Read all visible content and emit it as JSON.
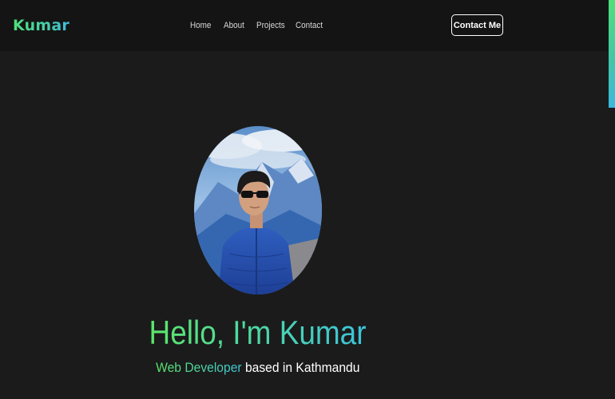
{
  "brand": {
    "logo_text": "Kumar"
  },
  "nav": {
    "links": [
      {
        "label": "Home"
      },
      {
        "label": "About"
      },
      {
        "label": "Projects"
      },
      {
        "label": "Contact"
      }
    ],
    "cta_label": "Contact Me"
  },
  "hero": {
    "headline": "Hello, I'm Kumar",
    "role": "Web Developer",
    "location_text": " based in Kathmandu",
    "avatar_alt": "profile-photo"
  },
  "scroll": {
    "progress": 0.27
  },
  "colors": {
    "background": "#1b1b1b",
    "navbar": "#141414",
    "accent_green": "#5be56a",
    "accent_cyan": "#3cc3dc"
  }
}
